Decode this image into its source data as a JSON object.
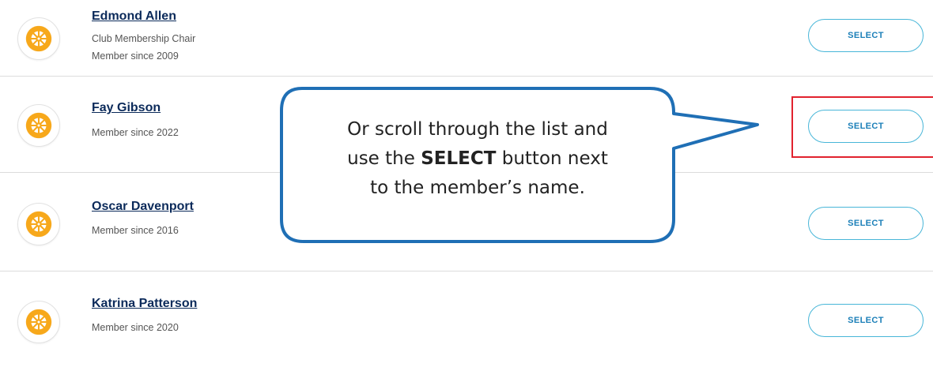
{
  "members": [
    {
      "name": "Edmond Allen",
      "role": "Club Membership Chair",
      "since": "Member since 2009",
      "button": "SELECT"
    },
    {
      "name": "Fay Gibson",
      "since": "Member since 2022",
      "button": "SELECT"
    },
    {
      "name": "Oscar Davenport",
      "since": "Member since 2016",
      "button": "SELECT"
    },
    {
      "name": "Katrina Patterson",
      "since": "Member since 2020",
      "button": "SELECT"
    }
  ],
  "callout": {
    "line1": "Or scroll through the list and",
    "line2_pre": "use the ",
    "line2_bold": "SELECT",
    "line2_post": " button next",
    "line3": "to the member’s name."
  },
  "colors": {
    "button_border": "#48b6d8",
    "button_text": "#1b7fb8",
    "callout_border": "#1f6fb5",
    "highlight": "#e1222e",
    "rotary_gold": "#f7a81b"
  },
  "icons": {
    "avatar": "rotary-wheel-icon"
  }
}
